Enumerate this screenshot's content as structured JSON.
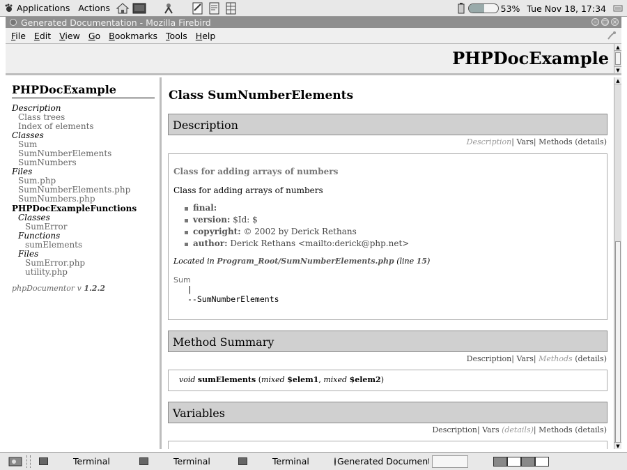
{
  "top_panel": {
    "applications_label": "Applications",
    "actions_label": "Actions",
    "battery_percent": "53%",
    "battery_level": 0.53,
    "clock": "Tue Nov 18, 17:34"
  },
  "window": {
    "title": "Generated Documentation - Mozilla Firebird"
  },
  "menubar": {
    "items": [
      "File",
      "Edit",
      "View",
      "Go",
      "Bookmarks",
      "Tools",
      "Help"
    ]
  },
  "header": {
    "title": "PHPDocExample"
  },
  "left_nav": {
    "title": "PHPDocExample",
    "description_label": "Description",
    "class_trees": "Class trees",
    "index_of_elements": "Index of elements",
    "classes_label": "Classes",
    "classes": [
      "Sum",
      "SumNumberElements",
      "SumNumbers"
    ],
    "files_label": "Files",
    "files": [
      "Sum.php",
      "SumNumberElements.php",
      "SumNumbers.php"
    ],
    "subpackage": "PHPDocExampleFunctions",
    "sub_classes_label": "Classes",
    "sub_classes": [
      "SumError"
    ],
    "sub_functions_label": "Functions",
    "sub_functions": [
      "sumElements"
    ],
    "sub_files_label": "Files",
    "sub_files": [
      "SumError.php",
      "utility.php"
    ],
    "footer_prefix": "phpDocumentor v ",
    "footer_version": "1.2.2"
  },
  "main": {
    "class_title": "Class SumNumberElements",
    "description": {
      "heading": "Description",
      "links": {
        "description": "Description",
        "vars": "Vars",
        "methods": "Methods",
        "details": "(details)",
        "sep": "|"
      },
      "short_desc": "Class for adding arrays of numbers",
      "long_desc": "Class for adding arrays of numbers",
      "tags": [
        {
          "name": "final:",
          "value": ""
        },
        {
          "name": "version:",
          "value": "$Id: $"
        },
        {
          "name": "copyright:",
          "value": "© 2002 by Derick Rethans"
        },
        {
          "name": "author:",
          "value": "Derick Rethans <mailto:derick@php.net>"
        }
      ],
      "located_prefix": "Located in ",
      "located_file": "Program_Root/SumNumberElements.php",
      "located_line_prefix": " (line ",
      "located_line": "15",
      "located_line_suffix": ")",
      "tree_root": "Sum",
      "tree_pipe": "|",
      "tree_child": "--SumNumberElements"
    },
    "method_summary": {
      "heading": "Method Summary",
      "return_type": "void",
      "method_name": "sumElements",
      "open_paren": " (",
      "param1_type": "mixed",
      "param1_name": "$elem1",
      "comma": ", ",
      "param2_type": "mixed",
      "param2_name": "$elem2",
      "close_paren": ")"
    },
    "variables": {
      "heading": "Variables"
    }
  },
  "taskbar": {
    "tasks": [
      "Terminal",
      "Terminal",
      "Terminal",
      "Generated Document:"
    ]
  }
}
